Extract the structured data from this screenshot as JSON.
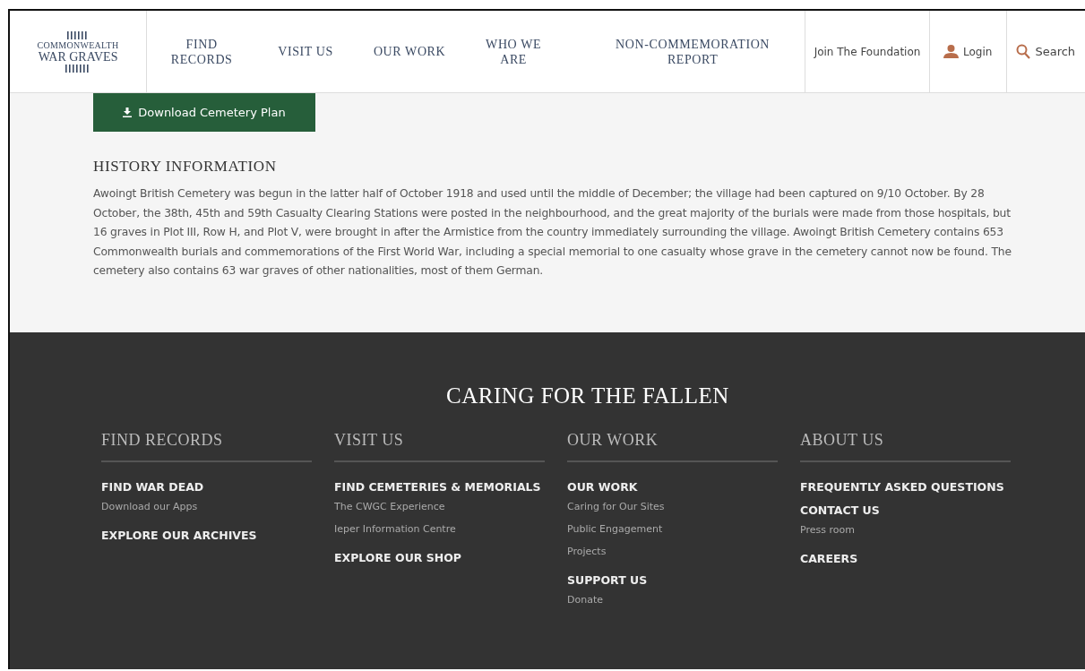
{
  "header": {
    "logo": {
      "line_1": "COMMONWEALTH",
      "line_2": "WAR GRAVES"
    },
    "nav": [
      "FIND RECORDS",
      "VISIT US",
      "OUR WORK",
      "WHO WE ARE",
      "NON-COMMEMORATION REPORT"
    ],
    "join": "Join The Foundation",
    "login": "Login",
    "search": "Search"
  },
  "download_button": "Download Cemetery Plan",
  "history": {
    "heading": "HISTORY INFORMATION",
    "text": "Awoingt British Cemetery was begun in the latter half of October 1918 and used until the middle of December; the village had been captured on 9/10 October. By 28 October, the 38th, 45th and 59th Casualty Clearing Stations were posted in the neighbourhood, and the great majority of the burials were made from those hospitals, but 16 graves in Plot III, Row H, and Plot V, were brought in after the Armistice from the country immediately surrounding the village. Awoingt British Cemetery contains 653 Commonwealth burials and commemorations of the First World War, including a special memorial to one casualty whose grave in the cemetery cannot now be found. The cemetery also contains 63 war graves of other nationalities, most of them German."
  },
  "footer": {
    "title": "CARING FOR THE FALLEN",
    "columns": [
      {
        "heading": "FIND RECORDS",
        "links": [
          {
            "kind": "main",
            "text": "FIND WAR DEAD"
          },
          {
            "kind": "sub",
            "text": "Download our Apps"
          },
          {
            "kind": "main",
            "text": "EXPLORE OUR ARCHIVES"
          }
        ]
      },
      {
        "heading": "VISIT US",
        "links": [
          {
            "kind": "main",
            "text": "FIND CEMETERIES & MEMORIALS"
          },
          {
            "kind": "sub",
            "text": "The CWGC Experience"
          },
          {
            "kind": "sub",
            "text": "Ieper Information Centre"
          },
          {
            "kind": "main",
            "text": "EXPLORE OUR SHOP"
          }
        ]
      },
      {
        "heading": "OUR WORK",
        "links": [
          {
            "kind": "main",
            "text": "OUR WORK"
          },
          {
            "kind": "sub",
            "text": "Caring for Our Sites"
          },
          {
            "kind": "sub",
            "text": "Public Engagement"
          },
          {
            "kind": "sub",
            "text": "Projects"
          },
          {
            "kind": "main",
            "text": "SUPPORT US"
          },
          {
            "kind": "sub",
            "text": "Donate"
          }
        ]
      },
      {
        "heading": "ABOUT US",
        "links": [
          {
            "kind": "main",
            "text": "FREQUENTLY ASKED QUESTIONS"
          },
          {
            "kind": "main",
            "text": "CONTACT US"
          },
          {
            "kind": "sub",
            "text": "Press room"
          },
          {
            "kind": "main",
            "text": "CAREERS"
          }
        ]
      }
    ]
  }
}
